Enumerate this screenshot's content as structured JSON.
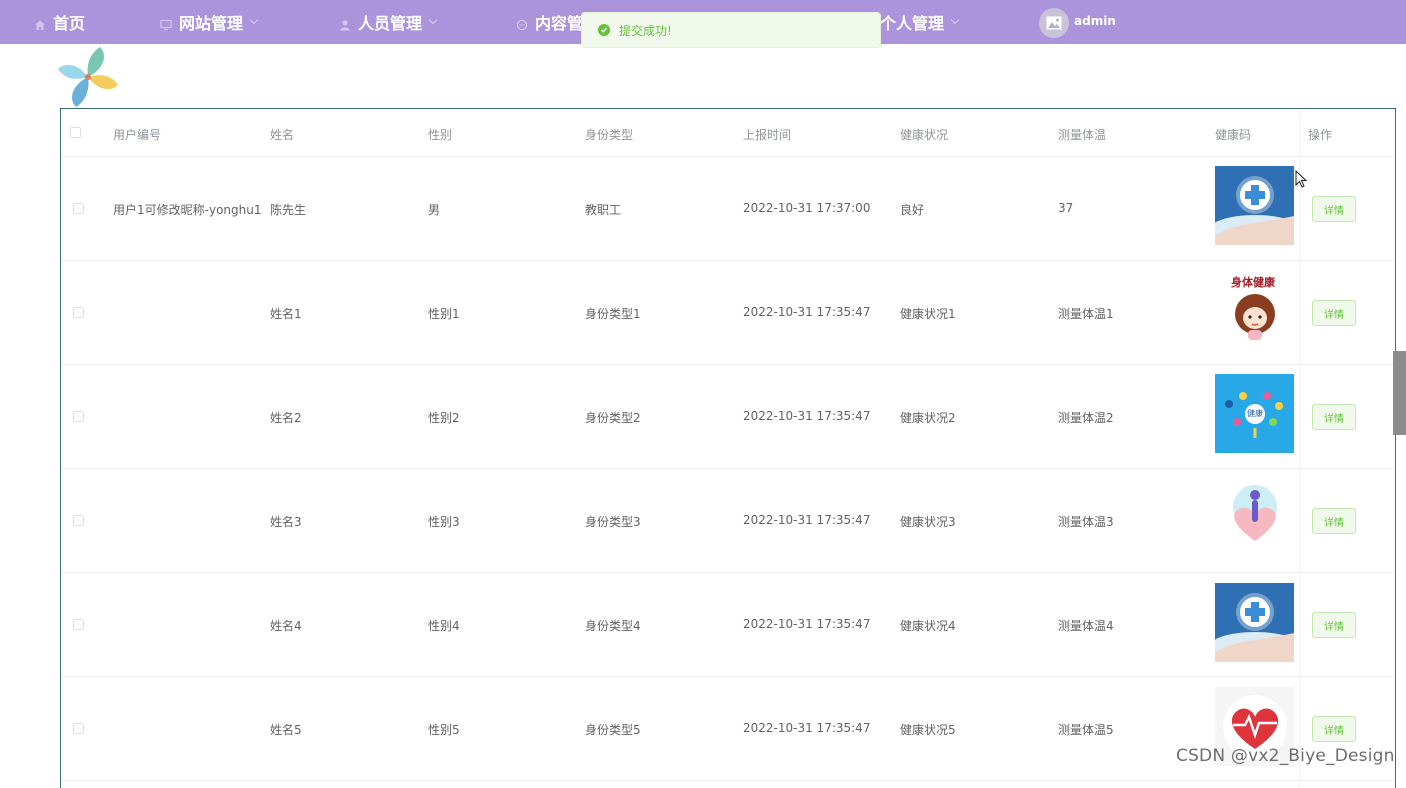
{
  "nav": {
    "home": "首页",
    "site_manage": "网站管理",
    "people_manage": "人员管理",
    "content_manage": "内容管",
    "personal_manage": "个人管理",
    "user": "admin"
  },
  "toast": {
    "message": "提交成功!"
  },
  "table": {
    "columns": [
      "用户编号",
      "姓名",
      "性别",
      "身份类型",
      "上报时间",
      "健康状况",
      "测量体温",
      "健康码",
      "操作"
    ],
    "rows": [
      {
        "user_id": "用户1可修改昵称-yonghu1",
        "name": "陈先生",
        "gender": "男",
        "identity": "教职工",
        "time": "2022-10-31 17:37:00",
        "health": "良好",
        "temp": "37",
        "image": "medical-cross",
        "action": "详情"
      },
      {
        "user_id": "",
        "name": "姓名1",
        "gender": "性别1",
        "identity": "身份类型1",
        "time": "2022-10-31 17:35:47",
        "health": "健康状况1",
        "temp": "测量体温1",
        "image": "cartoon-girl",
        "image_caption": "身体健康",
        "action": "详情"
      },
      {
        "user_id": "",
        "name": "姓名2",
        "gender": "性别2",
        "identity": "身份类型2",
        "time": "2022-10-31 17:35:47",
        "health": "健康状况2",
        "temp": "测量体温2",
        "image": "health-icons",
        "image_caption": "健康",
        "action": "详情"
      },
      {
        "user_id": "",
        "name": "姓名3",
        "gender": "性别3",
        "identity": "身份类型3",
        "time": "2022-10-31 17:35:47",
        "health": "健康状况3",
        "temp": "测量体温3",
        "image": "heart-hands",
        "action": "详情"
      },
      {
        "user_id": "",
        "name": "姓名4",
        "gender": "性别4",
        "identity": "身份类型4",
        "time": "2022-10-31 17:35:47",
        "health": "健康状况4",
        "temp": "测量体温4",
        "image": "medical-cross",
        "action": "详情"
      },
      {
        "user_id": "",
        "name": "姓名5",
        "gender": "性别5",
        "identity": "身份类型5",
        "time": "2022-10-31 17:35:47",
        "health": "健康状况5",
        "temp": "测量体温5",
        "image": "heart-pulse",
        "action": "详情"
      }
    ]
  },
  "watermark": "CSDN @vx2_Biye_Design",
  "colors": {
    "nav_bg": "#ab94db",
    "success": "#67c23a",
    "table_border": "#3f6c75"
  }
}
